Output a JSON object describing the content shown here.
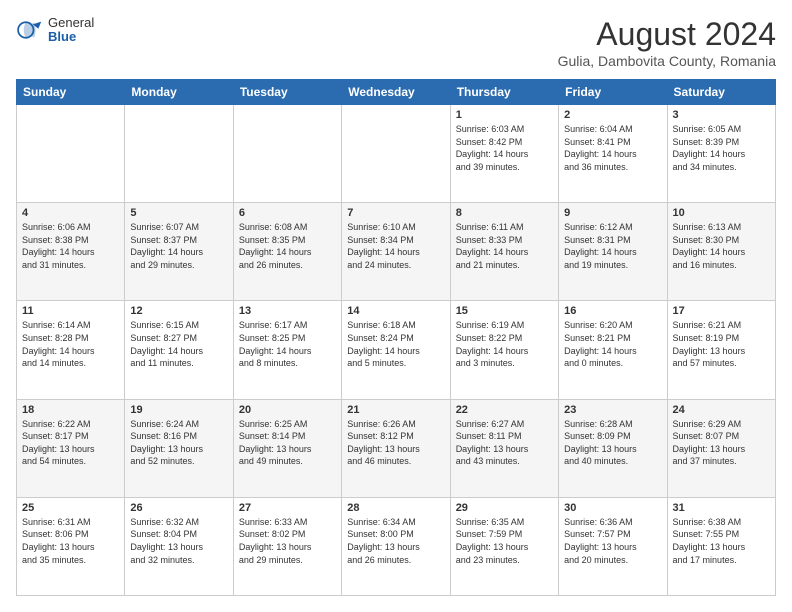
{
  "logo": {
    "general": "General",
    "blue": "Blue"
  },
  "title": "August 2024",
  "location": "Gulia, Dambovita County, Romania",
  "headers": [
    "Sunday",
    "Monday",
    "Tuesday",
    "Wednesday",
    "Thursday",
    "Friday",
    "Saturday"
  ],
  "weeks": [
    [
      {
        "day": "",
        "info": ""
      },
      {
        "day": "",
        "info": ""
      },
      {
        "day": "",
        "info": ""
      },
      {
        "day": "",
        "info": ""
      },
      {
        "day": "1",
        "info": "Sunrise: 6:03 AM\nSunset: 8:42 PM\nDaylight: 14 hours\nand 39 minutes."
      },
      {
        "day": "2",
        "info": "Sunrise: 6:04 AM\nSunset: 8:41 PM\nDaylight: 14 hours\nand 36 minutes."
      },
      {
        "day": "3",
        "info": "Sunrise: 6:05 AM\nSunset: 8:39 PM\nDaylight: 14 hours\nand 34 minutes."
      }
    ],
    [
      {
        "day": "4",
        "info": "Sunrise: 6:06 AM\nSunset: 8:38 PM\nDaylight: 14 hours\nand 31 minutes."
      },
      {
        "day": "5",
        "info": "Sunrise: 6:07 AM\nSunset: 8:37 PM\nDaylight: 14 hours\nand 29 minutes."
      },
      {
        "day": "6",
        "info": "Sunrise: 6:08 AM\nSunset: 8:35 PM\nDaylight: 14 hours\nand 26 minutes."
      },
      {
        "day": "7",
        "info": "Sunrise: 6:10 AM\nSunset: 8:34 PM\nDaylight: 14 hours\nand 24 minutes."
      },
      {
        "day": "8",
        "info": "Sunrise: 6:11 AM\nSunset: 8:33 PM\nDaylight: 14 hours\nand 21 minutes."
      },
      {
        "day": "9",
        "info": "Sunrise: 6:12 AM\nSunset: 8:31 PM\nDaylight: 14 hours\nand 19 minutes."
      },
      {
        "day": "10",
        "info": "Sunrise: 6:13 AM\nSunset: 8:30 PM\nDaylight: 14 hours\nand 16 minutes."
      }
    ],
    [
      {
        "day": "11",
        "info": "Sunrise: 6:14 AM\nSunset: 8:28 PM\nDaylight: 14 hours\nand 14 minutes."
      },
      {
        "day": "12",
        "info": "Sunrise: 6:15 AM\nSunset: 8:27 PM\nDaylight: 14 hours\nand 11 minutes."
      },
      {
        "day": "13",
        "info": "Sunrise: 6:17 AM\nSunset: 8:25 PM\nDaylight: 14 hours\nand 8 minutes."
      },
      {
        "day": "14",
        "info": "Sunrise: 6:18 AM\nSunset: 8:24 PM\nDaylight: 14 hours\nand 5 minutes."
      },
      {
        "day": "15",
        "info": "Sunrise: 6:19 AM\nSunset: 8:22 PM\nDaylight: 14 hours\nand 3 minutes."
      },
      {
        "day": "16",
        "info": "Sunrise: 6:20 AM\nSunset: 8:21 PM\nDaylight: 14 hours\nand 0 minutes."
      },
      {
        "day": "17",
        "info": "Sunrise: 6:21 AM\nSunset: 8:19 PM\nDaylight: 13 hours\nand 57 minutes."
      }
    ],
    [
      {
        "day": "18",
        "info": "Sunrise: 6:22 AM\nSunset: 8:17 PM\nDaylight: 13 hours\nand 54 minutes."
      },
      {
        "day": "19",
        "info": "Sunrise: 6:24 AM\nSunset: 8:16 PM\nDaylight: 13 hours\nand 52 minutes."
      },
      {
        "day": "20",
        "info": "Sunrise: 6:25 AM\nSunset: 8:14 PM\nDaylight: 13 hours\nand 49 minutes."
      },
      {
        "day": "21",
        "info": "Sunrise: 6:26 AM\nSunset: 8:12 PM\nDaylight: 13 hours\nand 46 minutes."
      },
      {
        "day": "22",
        "info": "Sunrise: 6:27 AM\nSunset: 8:11 PM\nDaylight: 13 hours\nand 43 minutes."
      },
      {
        "day": "23",
        "info": "Sunrise: 6:28 AM\nSunset: 8:09 PM\nDaylight: 13 hours\nand 40 minutes."
      },
      {
        "day": "24",
        "info": "Sunrise: 6:29 AM\nSunset: 8:07 PM\nDaylight: 13 hours\nand 37 minutes."
      }
    ],
    [
      {
        "day": "25",
        "info": "Sunrise: 6:31 AM\nSunset: 8:06 PM\nDaylight: 13 hours\nand 35 minutes."
      },
      {
        "day": "26",
        "info": "Sunrise: 6:32 AM\nSunset: 8:04 PM\nDaylight: 13 hours\nand 32 minutes."
      },
      {
        "day": "27",
        "info": "Sunrise: 6:33 AM\nSunset: 8:02 PM\nDaylight: 13 hours\nand 29 minutes."
      },
      {
        "day": "28",
        "info": "Sunrise: 6:34 AM\nSunset: 8:00 PM\nDaylight: 13 hours\nand 26 minutes."
      },
      {
        "day": "29",
        "info": "Sunrise: 6:35 AM\nSunset: 7:59 PM\nDaylight: 13 hours\nand 23 minutes."
      },
      {
        "day": "30",
        "info": "Sunrise: 6:36 AM\nSunset: 7:57 PM\nDaylight: 13 hours\nand 20 minutes."
      },
      {
        "day": "31",
        "info": "Sunrise: 6:38 AM\nSunset: 7:55 PM\nDaylight: 13 hours\nand 17 minutes."
      }
    ]
  ]
}
